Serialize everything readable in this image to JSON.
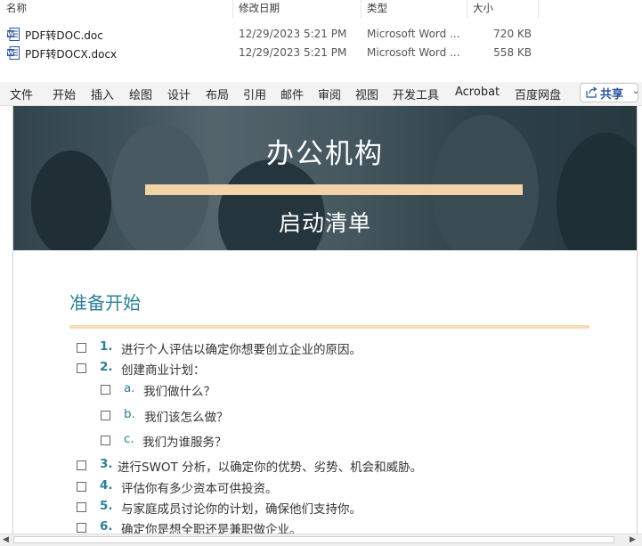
{
  "explorer": {
    "columns": {
      "name": "名称",
      "modified": "修改日期",
      "type": "类型",
      "size": "大小"
    },
    "files": [
      {
        "name": "PDF转DOC.doc",
        "modified": "12/29/2023 5:21 PM",
        "type": "Microsoft Word ...",
        "size": "720 KB",
        "icon": "word-doc-icon"
      },
      {
        "name": "PDF转DOCX.docx",
        "modified": "12/29/2023 5:21 PM",
        "type": "Microsoft Word ...",
        "size": "558 KB",
        "icon": "word-doc-icon"
      }
    ]
  },
  "ribbon": {
    "tabs": [
      "文件",
      "开始",
      "插入",
      "绘图",
      "设计",
      "布局",
      "引用",
      "邮件",
      "审阅",
      "视图",
      "开发工具",
      "Acrobat",
      "百度网盘"
    ],
    "share_label": "共享",
    "share_icon": "share-icon"
  },
  "document": {
    "banner_title": "办公机构",
    "banner_subtitle": "启动清单",
    "section_heading": "准备开始",
    "items": [
      {
        "num": "1.",
        "text": "进行个人评估以确定你想要创立企业的原因。"
      },
      {
        "num": "2.",
        "text": "创建商业计划："
      },
      {
        "num": "a.",
        "text": "我们做什么？"
      },
      {
        "num": "b.",
        "text": "我们该怎么做？"
      },
      {
        "num": "c.",
        "text": "我们为谁服务？"
      },
      {
        "num": "3.",
        "text": "进行SWOT 分析，以确定你的优势、劣势、机会和威胁。"
      },
      {
        "num": "4.",
        "text": "评估你有多少资本可供投资。"
      },
      {
        "num": "5.",
        "text": "与家庭成员讨论你的计划，确保他们支持你。"
      },
      {
        "num": "6.",
        "text": "确定你是想全职还是兼职做企业。"
      }
    ],
    "colors": {
      "accent": "#2f7f98",
      "rule": "#f6dcb9",
      "banner_bar": "#f2d3a8"
    }
  }
}
